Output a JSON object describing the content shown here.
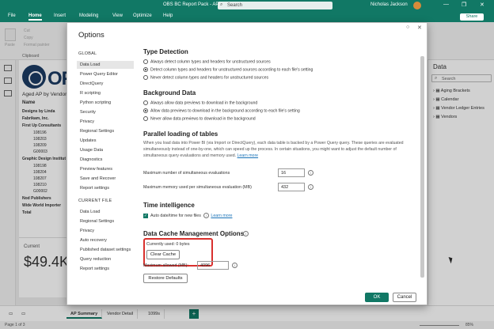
{
  "titlebar": {
    "doc_title": "OBS BC Report Pack - AP • Last saved: 1/29/2024 at 8:50 AM",
    "search_placeholder": "Search",
    "user": "Nicholas Jackson",
    "minimize": "—",
    "restore": "❐",
    "close": "✕"
  },
  "menubar": {
    "items": [
      "File",
      "Home",
      "Insert",
      "Modeling",
      "View",
      "Optimize",
      "Help"
    ],
    "share": "Share"
  },
  "ribbon": {
    "paste": "Paste",
    "cut": "Cut",
    "copy": "Copy",
    "format_painter": "Format painter",
    "clipboard": "Clipboard"
  },
  "report": {
    "logo_text": "OF",
    "title": "Aged AP by Vendor",
    "column_header": "Name",
    "rows": [
      {
        "text": "Designs by Linda",
        "bold": true
      },
      {
        "text": "Fabrikam, Inc.",
        "bold": true
      },
      {
        "text": "First Up Consultants",
        "bold": true
      },
      {
        "text": "108196",
        "bold": false
      },
      {
        "text": "108203",
        "bold": false
      },
      {
        "text": "108209",
        "bold": false
      },
      {
        "text": "G00003",
        "bold": false
      },
      {
        "text": "Graphic Design Institut",
        "bold": true
      },
      {
        "text": "108198",
        "bold": false
      },
      {
        "text": "108204",
        "bold": false
      },
      {
        "text": "108207",
        "bold": false
      },
      {
        "text": "108210",
        "bold": false
      },
      {
        "text": "G00002",
        "bold": false
      },
      {
        "text": "Nod Publishers",
        "bold": true
      },
      {
        "text": "Wide World Importer",
        "bold": true
      },
      {
        "text": "Total",
        "bold": true
      }
    ],
    "card_label": "Current",
    "card_value": "$49.4K"
  },
  "data_pane": {
    "title": "Data",
    "search_placeholder": "Search",
    "items": [
      "Aging Brackets",
      "Calendar",
      "Vendor Ledger Entries",
      "Vendors"
    ]
  },
  "dialog": {
    "title": "Options",
    "global_label": "GLOBAL",
    "global_items": [
      "Data Load",
      "Power Query Editor",
      "DirectQuery",
      "R scripting",
      "Python scripting",
      "Security",
      "Privacy",
      "Regional Settings",
      "Updates",
      "Usage Data",
      "Diagnostics",
      "Preview features",
      "Save and Recover",
      "Report settings"
    ],
    "current_label": "CURRENT FILE",
    "current_items": [
      "Data Load",
      "Regional Settings",
      "Privacy",
      "Auto recovery",
      "Published dataset settings",
      "Query reduction",
      "Report settings"
    ],
    "type_detection": {
      "heading": "Type Detection",
      "options": [
        "Always detect column types and headers for unstructured sources",
        "Detect column types and headers for unstructured sources according to each file's setting",
        "Never detect column types and headers for unstructured sources"
      ],
      "selected": 1
    },
    "background_data": {
      "heading": "Background Data",
      "options": [
        "Always allow data previews to download in the background",
        "Allow data previews to download in the background according to each file's setting",
        "Never allow data previews to download in the background"
      ],
      "selected": 1
    },
    "parallel": {
      "heading": "Parallel loading of tables",
      "description": "When you load data into Power BI (via Import or DirectQuery), each data table is backed by a Power Query query. These queries are evaluated simultaneously instead of one-by-one, which can speed up the process. In certain situations, you might want to adjust the default number of simultaneous query evaluations and memory used.",
      "learn_more": "Learn more",
      "max_evals_label": "Maximum number of simultaneous evaluations",
      "max_evals_value": "16",
      "max_mem_label": "Maximum memory used per simultaneous evaluation (MB)",
      "max_mem_value": "432"
    },
    "time_intel": {
      "heading": "Time intelligence",
      "checkbox_label": "Auto date/time for new files",
      "learn_more": "Learn more"
    },
    "cache": {
      "heading": "Data Cache Management Options",
      "currently_used": "Currently used: 0 bytes",
      "clear_cache": "Clear Cache",
      "max_allowed_label": "Maximum allowed (MB):",
      "max_allowed_value": "4096",
      "restore_defaults": "Restore Defaults"
    },
    "ok": "OK",
    "cancel": "Cancel"
  },
  "tabs": {
    "items": [
      "AP Summary",
      "Vendor Detail",
      "1099s"
    ],
    "active": 0
  },
  "status": {
    "page": "Page 1 of 3",
    "zoom": "85%"
  }
}
